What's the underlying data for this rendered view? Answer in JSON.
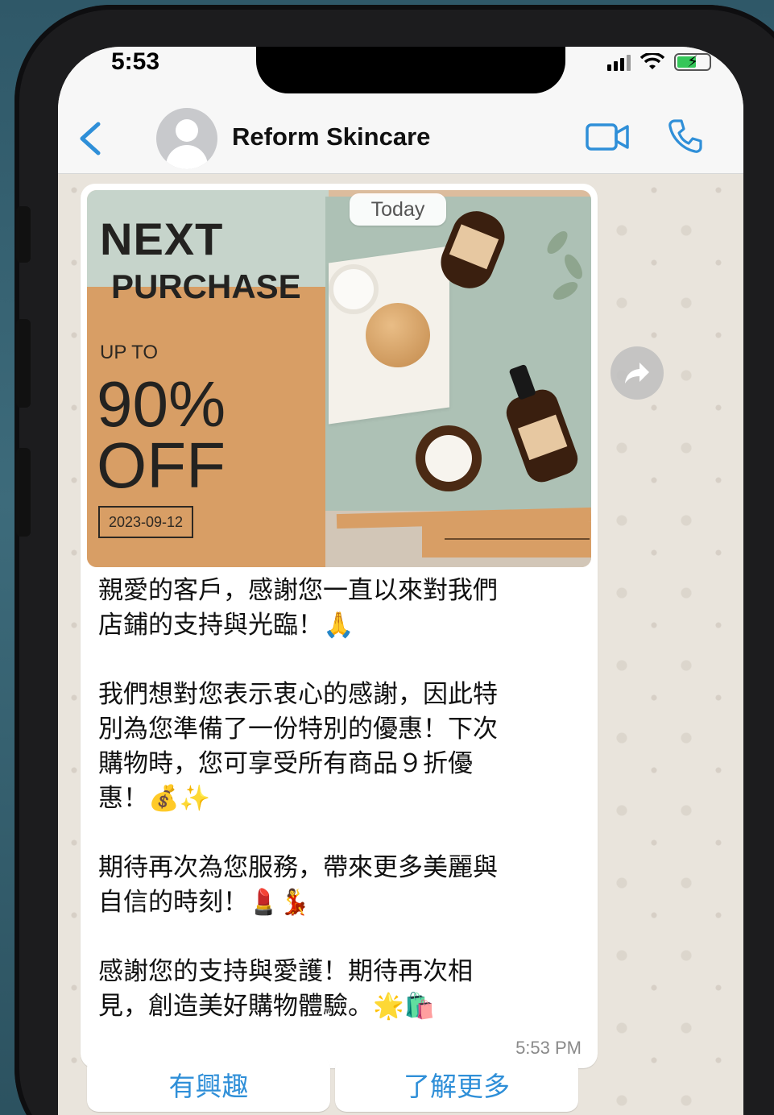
{
  "status_bar": {
    "time": "5:53"
  },
  "header": {
    "contact_name": "Reform Skincare"
  },
  "promo_image": {
    "line1": "NEXT",
    "line2": "PURCHASE",
    "up_to": "UP TO",
    "percent": "90%",
    "off": "OFF",
    "date": "2023-09-12"
  },
  "date_divider": "Today",
  "message": {
    "paragraphs": [
      "親愛的客戶，感謝您一直以來對我們\n店鋪的支持與光臨！🙏",
      "我們想對您表示衷心的感謝，因此特\n別為您準備了一份特別的優惠！下次\n購物時，您可享受所有商品９折優\n惠！💰✨",
      "期待再次為您服務，帶來更多美麗與\n自信的時刻！💄💃",
      "感謝您的支持與愛護！期待再次相\n見，創造美好購物體驗。🌟🛍️"
    ],
    "time": "5:53 PM"
  },
  "quick_replies": [
    "有興趣",
    "了解更多"
  ],
  "colors": {
    "accent_blue": "#2f8fd8",
    "promo_orange": "#d89e65",
    "chat_bg": "#e9e4dc"
  },
  "icons": [
    "back-chevron-icon",
    "avatar-icon",
    "video-call-icon",
    "phone-call-icon",
    "forward-icon",
    "signal-icon",
    "wifi-icon",
    "battery-icon"
  ]
}
